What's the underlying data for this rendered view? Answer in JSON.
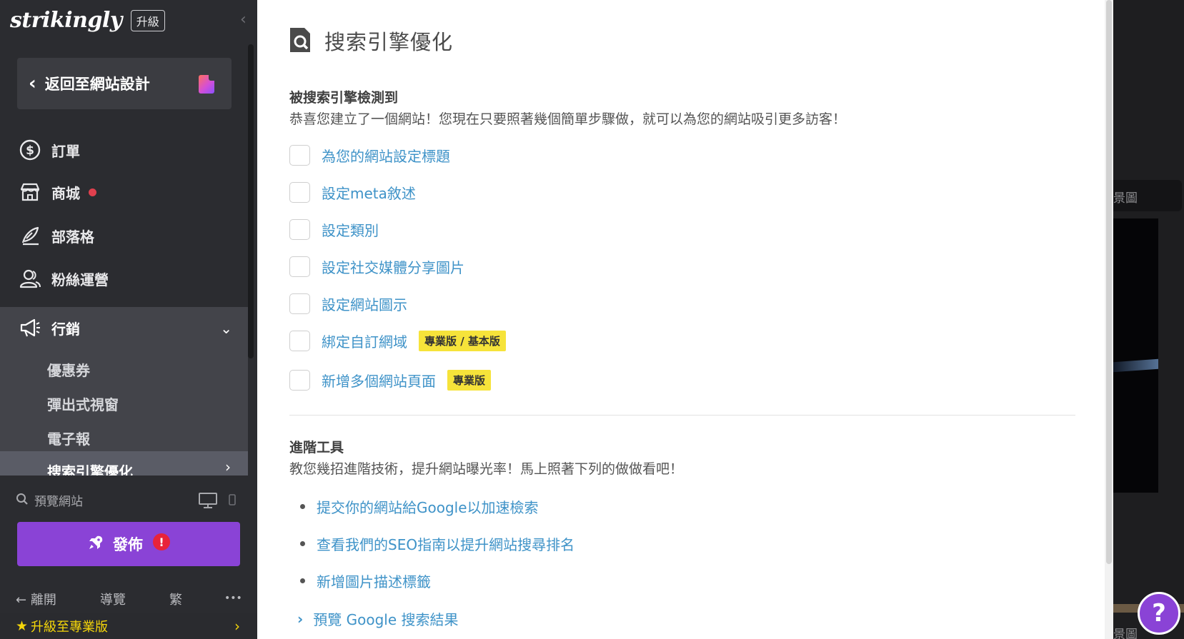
{
  "brand": {
    "logo": "strikingly",
    "badge": "升級"
  },
  "sidebar": {
    "back_label": "返回至網站設計",
    "items": [
      {
        "label": "訂單",
        "icon": "dollar-circle-icon"
      },
      {
        "label": "商城",
        "icon": "store-icon",
        "has_dot": true
      },
      {
        "label": "部落格",
        "icon": "quill-icon"
      },
      {
        "label": "粉絲運營",
        "icon": "users-icon"
      },
      {
        "label": "行銷",
        "icon": "megaphone-icon",
        "expanded": true
      }
    ],
    "sub_items": [
      {
        "label": "優惠券"
      },
      {
        "label": "彈出式視窗"
      },
      {
        "label": "電子報"
      },
      {
        "label": "搜索引擎優化",
        "active": true
      }
    ],
    "preview_label": "預覽網站",
    "publish_label": "發佈",
    "publish_alert": "!",
    "footer": {
      "exit": "離開",
      "tour": "導覽",
      "lang": "繁",
      "more": "•••"
    },
    "upgrade_label": "升級至專業版"
  },
  "main": {
    "title": "搜索引擎優化",
    "section1": {
      "title": "被搜索引擎檢測到",
      "desc": "恭喜您建立了一個網站！您現在只要照著幾個簡單步驟做，就可以為您的網站吸引更多訪客！",
      "tasks": [
        {
          "label": "為您的網站設定標題",
          "checked": false
        },
        {
          "label": "設定meta敘述",
          "checked": false
        },
        {
          "label": "設定類別",
          "checked": false
        },
        {
          "label": "設定社交媒體分享圖片",
          "checked": false
        },
        {
          "label": "設定網站圖示",
          "checked": false
        },
        {
          "label": "綁定自訂網域",
          "checked": false,
          "tag": "專業版 / 基本版"
        },
        {
          "label": "新增多個網站頁面",
          "checked": false,
          "tag": "專業版"
        }
      ]
    },
    "section2": {
      "title": "進階工具",
      "desc": "教您幾招進階技術，提升網站曝光率！馬上照著下列的做做看吧！",
      "links": [
        {
          "label": "提交你的網站給Google以加速檢索"
        },
        {
          "label": "查看我們的SEO指南以提升網站搜尋排名"
        },
        {
          "label": "新增圖片描述標籤"
        }
      ],
      "expand_label": "預覽 Google 搜索結果"
    }
  },
  "background_preview": {
    "label_top": "景圖",
    "label_bottom": "景圖"
  },
  "help": {
    "label": "?"
  },
  "colors": {
    "accent": "#8a43d6",
    "link": "#3f93c8",
    "tag": "#f6e33a",
    "upgrade": "#f5d60a"
  }
}
